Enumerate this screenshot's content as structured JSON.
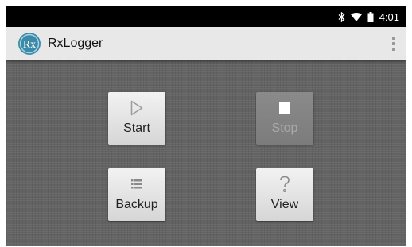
{
  "status_bar": {
    "time": "4:01",
    "icons": [
      "bluetooth-icon",
      "wifi-icon",
      "battery-icon"
    ]
  },
  "app_bar": {
    "title": "RxLogger",
    "logo_text": "Rx",
    "menu_icon": "overflow-menu-icon"
  },
  "buttons": {
    "start": {
      "label": "Start",
      "icon": "play-icon",
      "enabled": true
    },
    "stop": {
      "label": "Stop",
      "icon": "stop-icon",
      "enabled": false
    },
    "backup": {
      "label": "Backup",
      "icon": "list-icon",
      "enabled": true
    },
    "view": {
      "label": "View",
      "icon": "question-icon",
      "enabled": true
    }
  },
  "colors": {
    "status_bar": "#000000",
    "app_bar": "#e8e8e8",
    "background": "#636363",
    "logo": "#3a8aa8"
  }
}
